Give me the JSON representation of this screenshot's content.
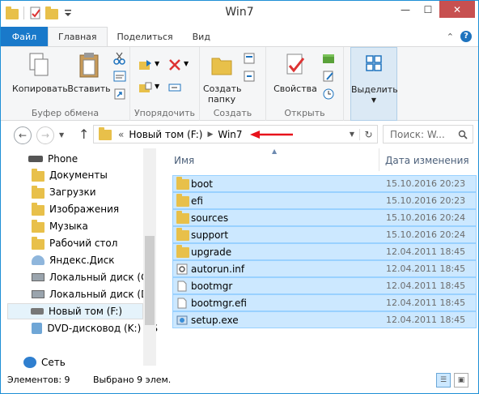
{
  "window": {
    "title": "Win7"
  },
  "tabs": {
    "file": "Файл",
    "home": "Главная",
    "share": "Поделиться",
    "view": "Вид"
  },
  "ribbon": {
    "clipboard": {
      "copy": "Копировать",
      "paste": "Вставить",
      "label": "Буфер обмена"
    },
    "organize": {
      "label": "Упорядочить"
    },
    "create": {
      "new_folder_line1": "Создать",
      "new_folder_line2": "папку",
      "label": "Создать"
    },
    "open": {
      "properties": "Свойства",
      "label": "Открыть"
    },
    "select": {
      "select": "Выделить"
    }
  },
  "address": {
    "prefix": "«",
    "segment1": "Новый том (F:)",
    "segment2": "Win7",
    "search_placeholder": "Поиск: W..."
  },
  "nav": {
    "items": [
      {
        "label": "Phone",
        "icon": "phone-drive-icon"
      },
      {
        "label": "Документы",
        "icon": "folder-icon"
      },
      {
        "label": "Загрузки",
        "icon": "downloads-folder-icon"
      },
      {
        "label": "Изображения",
        "icon": "pictures-folder-icon"
      },
      {
        "label": "Музыка",
        "icon": "music-folder-icon"
      },
      {
        "label": "Рабочий стол",
        "icon": "folder-icon"
      },
      {
        "label": "Яндекс.Диск",
        "icon": "yandex-disk-icon"
      },
      {
        "label": "Локальный диск (C:)",
        "icon": "drive-icon"
      },
      {
        "label": "Локальный диск (D:)",
        "icon": "drive-icon"
      },
      {
        "label": "Новый том (F:)",
        "icon": "drive-icon"
      },
      {
        "label": "DVD-дисковод (K:) GS",
        "icon": "dvd-icon"
      },
      {
        "label": "Сеть",
        "icon": "network-icon"
      }
    ]
  },
  "files": {
    "col_name": "Имя",
    "col_date": "Дата изменения",
    "rows": [
      {
        "name": "boot",
        "date": "15.10.2016 20:23",
        "type": "folder"
      },
      {
        "name": "efi",
        "date": "15.10.2016 20:23",
        "type": "folder"
      },
      {
        "name": "sources",
        "date": "15.10.2016 20:24",
        "type": "folder"
      },
      {
        "name": "support",
        "date": "15.10.2016 20:24",
        "type": "folder"
      },
      {
        "name": "upgrade",
        "date": "12.04.2011 18:45",
        "type": "folder"
      },
      {
        "name": "autorun.inf",
        "date": "12.04.2011 18:45",
        "type": "settings-file"
      },
      {
        "name": "bootmgr",
        "date": "12.04.2011 18:45",
        "type": "file"
      },
      {
        "name": "bootmgr.efi",
        "date": "12.04.2011 18:45",
        "type": "file"
      },
      {
        "name": "setup.exe",
        "date": "12.04.2011 18:45",
        "type": "exe"
      }
    ]
  },
  "status": {
    "count": "Элементов: 9",
    "selected": "Выбрано 9 элем."
  },
  "colors": {
    "accent": "#1979ca",
    "selection": "#cce8ff",
    "close": "#c75050",
    "annotation": "#e8121b"
  }
}
